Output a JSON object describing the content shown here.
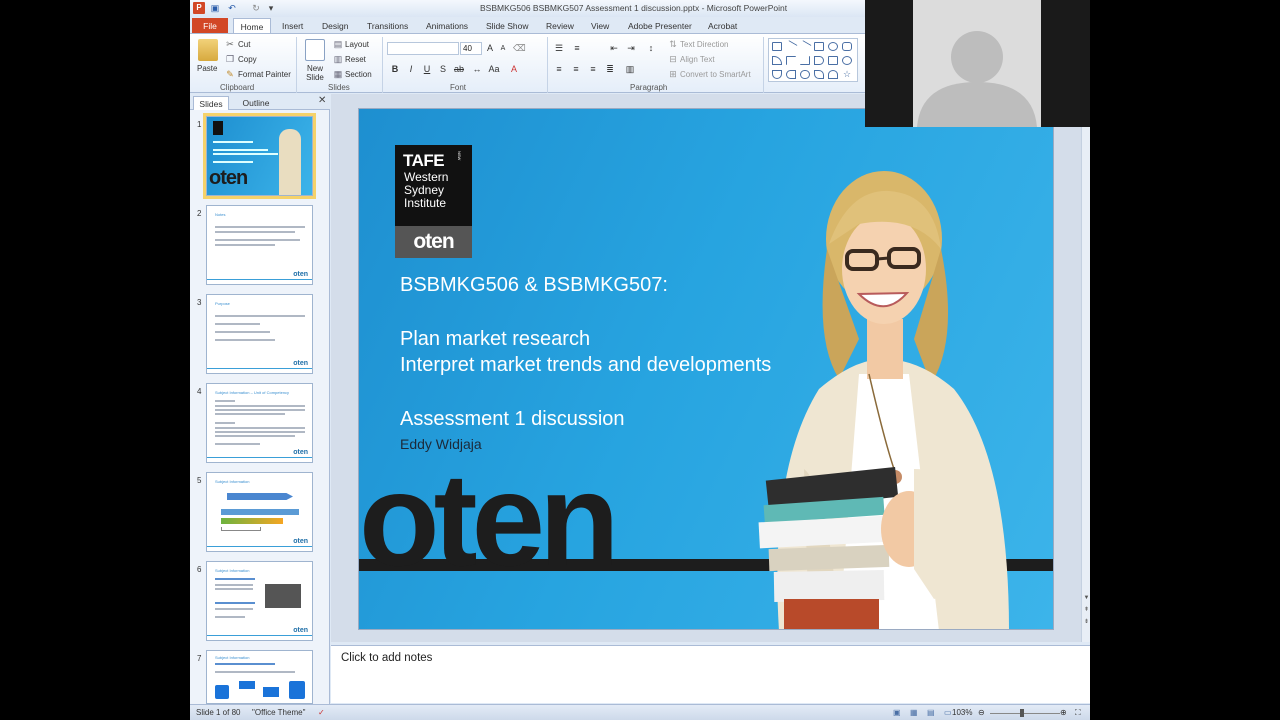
{
  "window": {
    "title": "BSBMKG506 BSBMKG507 Assessment 1 discussion.pptx  -  Microsoft PowerPoint",
    "app_icon": "P"
  },
  "tabs": [
    "File",
    "Home",
    "Insert",
    "Design",
    "Transitions",
    "Animations",
    "Slide Show",
    "Review",
    "View",
    "Adobe Presenter",
    "Acrobat"
  ],
  "ribbon": {
    "clipboard": {
      "paste": "Paste",
      "cut": "Cut",
      "copy": "Copy",
      "format_painter": "Format Painter",
      "label": "Clipboard"
    },
    "slides": {
      "new_slide": "New Slide",
      "layout": "Layout",
      "reset": "Reset",
      "section": "Section",
      "label": "Slides"
    },
    "font": {
      "font_size": "40",
      "label": "Font"
    },
    "paragraph": {
      "text_direction": "Text Direction",
      "align_text": "Align Text",
      "convert_smartart": "Convert to SmartArt",
      "label": "Paragraph"
    }
  },
  "panel": {
    "tab_slides": "Slides",
    "tab_outline": "Outline",
    "thumbnails": [
      {
        "num": "1",
        "logo": "oten"
      },
      {
        "num": "2",
        "title": "Notes",
        "logo": "oten"
      },
      {
        "num": "3",
        "title": "Purpose",
        "logo": "oten"
      },
      {
        "num": "4",
        "title": "Subject Information – Unit of Competency",
        "logo": "oten"
      },
      {
        "num": "5",
        "title": "Subject Information",
        "logo": "oten"
      },
      {
        "num": "6",
        "title": "Subject Information",
        "logo": "oten"
      },
      {
        "num": "7",
        "title": "Subject Information"
      }
    ]
  },
  "slide": {
    "logo_tafe": "TAFE",
    "logo_nsw": "NSW",
    "logo_lines": [
      "Western",
      "Sydney",
      "Institute"
    ],
    "logo_oten": "oten",
    "course_codes": "BSBMKG506 & BSBMKG507:",
    "line1": "Plan market research",
    "line2": "Interpret market trends and developments",
    "assessment": "Assessment 1 discussion",
    "presenter": "Eddy Widjaja",
    "brand": "oten"
  },
  "notes": {
    "placeholder": "Click to add notes"
  },
  "status": {
    "slide_info": "Slide 1 of 80",
    "theme": "\"Office Theme\"",
    "zoom": "103%"
  },
  "colors": {
    "file_tab": "#d24726",
    "slide_blue": "#27a4e0",
    "selection": "#f5d26a"
  }
}
